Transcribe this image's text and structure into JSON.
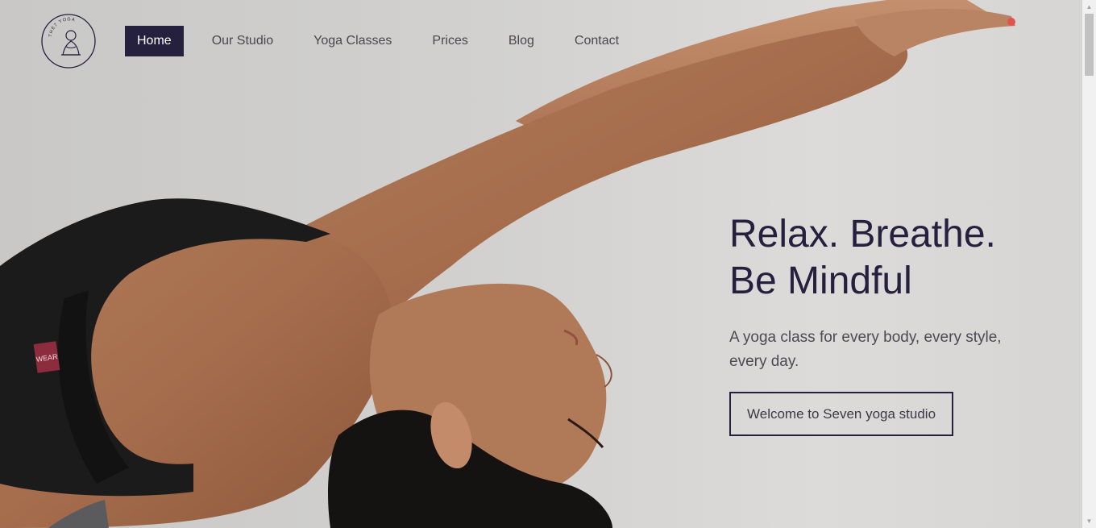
{
  "brand": {
    "logo_text": "THE7 YOGA"
  },
  "nav": {
    "items": [
      {
        "label": "Home",
        "active": true
      },
      {
        "label": "Our Studio",
        "active": false
      },
      {
        "label": "Yoga Classes",
        "active": false
      },
      {
        "label": "Prices",
        "active": false
      },
      {
        "label": "Blog",
        "active": false
      },
      {
        "label": "Contact",
        "active": false
      }
    ]
  },
  "hero": {
    "title_line1": "Relax. Breathe.",
    "title_line2": "Be Mindful",
    "subtitle": "A yoga class for every body, every style, every day.",
    "cta_label": "Welcome to Seven yoga studio",
    "bra_logo": "WEAR"
  },
  "colors": {
    "accent": "#26203f",
    "background": "#d2d1cf",
    "text_muted": "#4d4a54"
  },
  "icons": {
    "logo": "yoga-pose-logo-icon",
    "scroll_up": "triangle-up-icon",
    "scroll_down": "triangle-down-icon"
  }
}
